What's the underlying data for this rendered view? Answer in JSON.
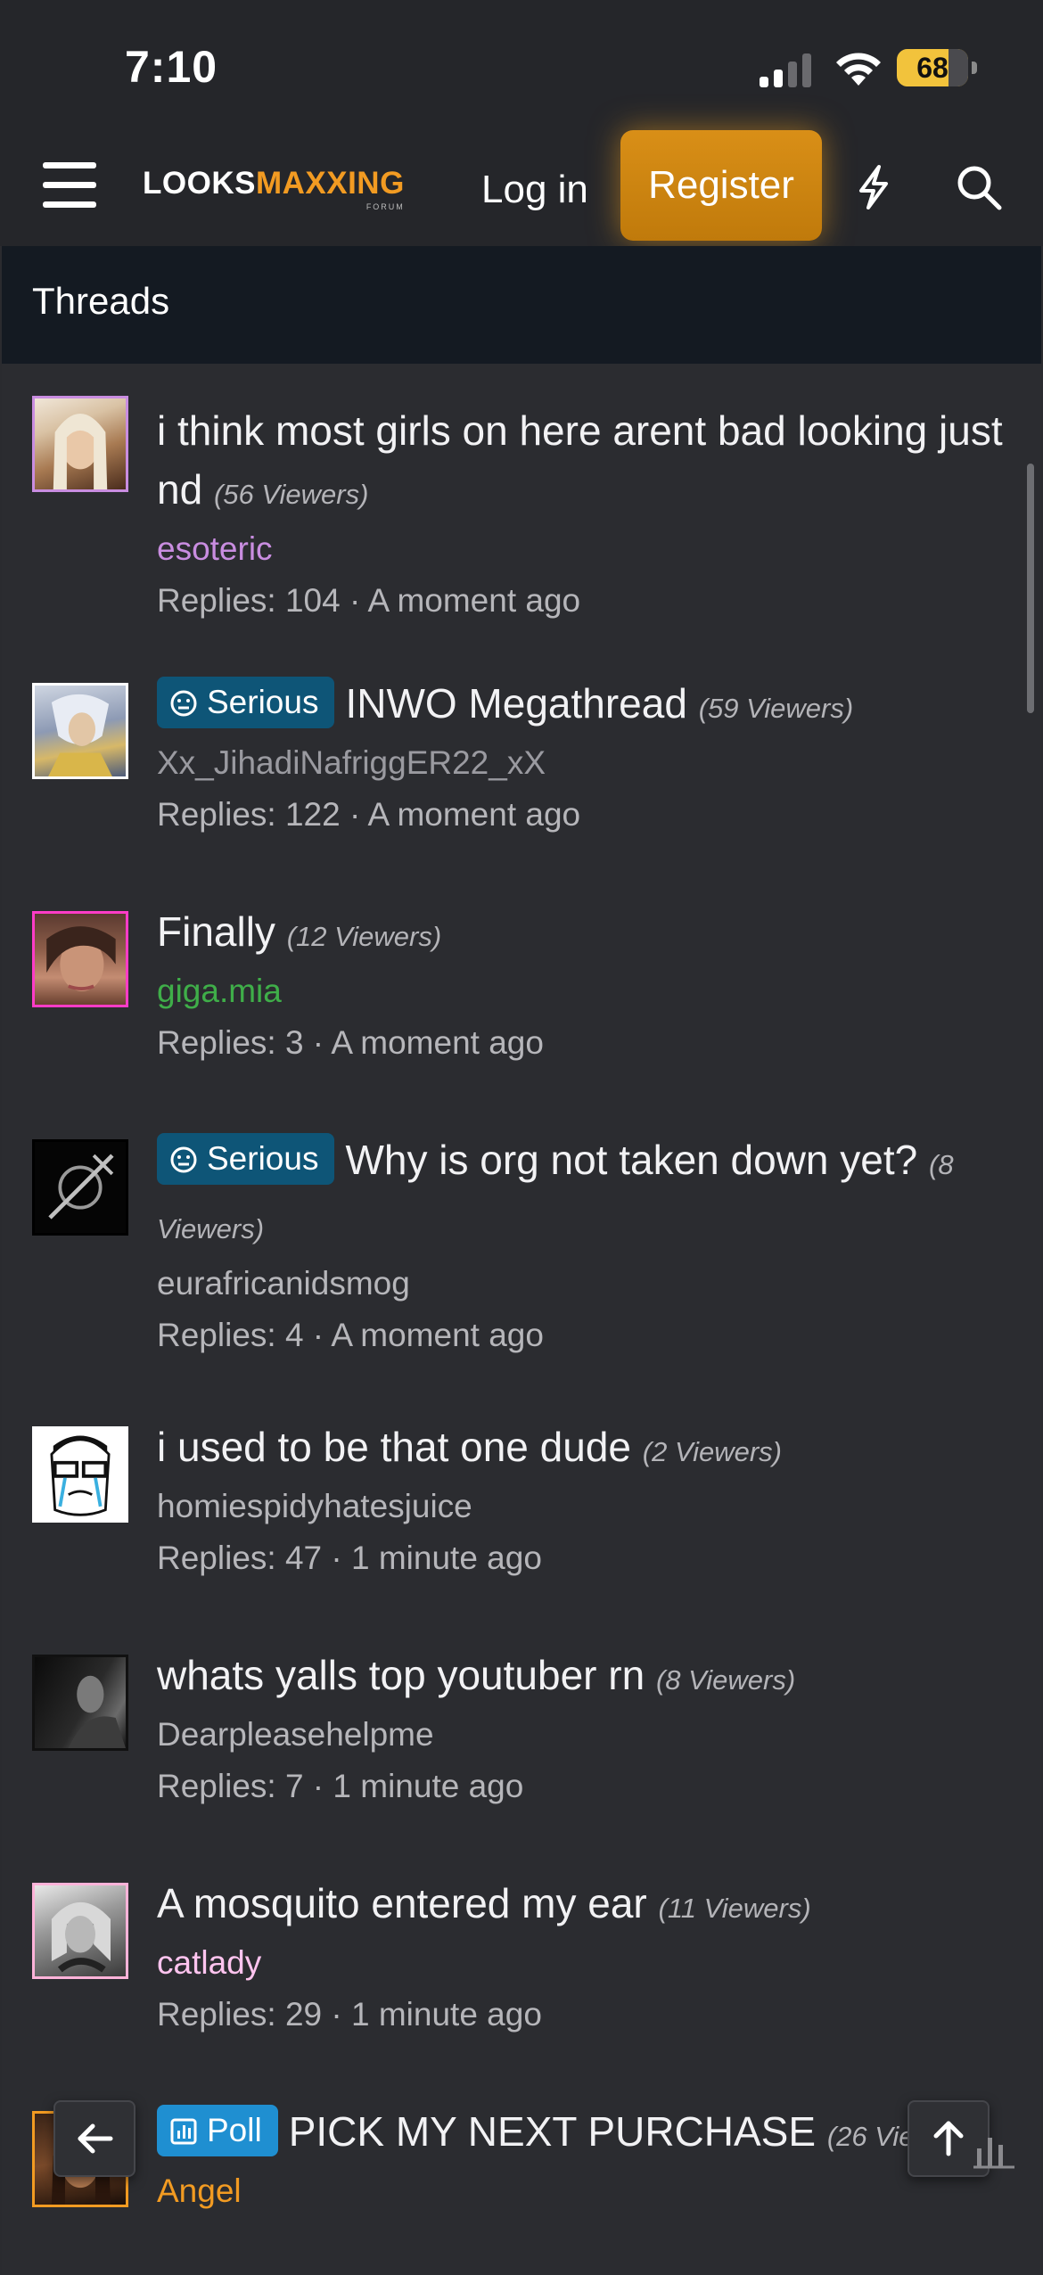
{
  "status_bar": {
    "time": "7:10",
    "battery": "68"
  },
  "nav": {
    "logo_white": "LOOKS",
    "logo_orange": "MAXXING",
    "logo_sub": "FORUM",
    "login_label": "Log in",
    "register_label": "Register"
  },
  "section_title": "Threads",
  "threads": [
    {
      "prefix": "",
      "title": "i think most girls on here arent bad looking just nd",
      "viewers": "(56 Viewers)",
      "author": "esoteric",
      "author_color": "#c98de0",
      "meta": "Replies: 104 · A moment ago",
      "avatar_border": "#c98de0"
    },
    {
      "prefix": "Serious",
      "title": "INWO Megathread",
      "viewers": "(59 Viewers)",
      "author": "Xx_JihadiNafriggER22_xX",
      "author_color": "#9a9aa0",
      "meta": "Replies: 122 · A moment ago",
      "avatar_border": "#ffffff"
    },
    {
      "prefix": "",
      "title": "Finally",
      "viewers": "(12 Viewers)",
      "author": "giga.mia",
      "author_color": "#3fae49",
      "meta": "Replies: 3 · A moment ago",
      "avatar_border": "#ff3cc7"
    },
    {
      "prefix": "Serious",
      "title": "Why is org not taken down yet?",
      "viewers": "(8 Viewers)",
      "author": "eurafricanidsmog",
      "author_color": "#b6b6ba",
      "meta": "Replies: 4 · A moment ago",
      "avatar_border": "#000000"
    },
    {
      "prefix": "",
      "title": "i used to be that one dude",
      "viewers": "(2 Viewers)",
      "author": "homiespidyhatesjuice",
      "author_color": "#b6b6ba",
      "meta": "Replies: 47 · 1 minute ago",
      "avatar_border": "#ffffff"
    },
    {
      "prefix": "",
      "title": "whats yalls top youtuber rn",
      "viewers": "(8 Viewers)",
      "author": "Dearpleasehelpme",
      "author_color": "#b6b6ba",
      "meta": "Replies: 7 · 1 minute ago",
      "avatar_border": "#111111"
    },
    {
      "prefix": "",
      "title": "A mosquito entered my ear",
      "viewers": "(11 Viewers)",
      "author": "catlady",
      "author_color": "#ffc4ef",
      "meta": "Replies: 29 · 1 minute ago",
      "avatar_border": "#ffb3d9"
    },
    {
      "prefix": "Poll",
      "title": "PICK MY NEXT PURCHASE",
      "viewers": "(26 Viewers)",
      "author": "Angel",
      "author_color": "#f29b22",
      "meta": "",
      "avatar_border": "#f29b22"
    }
  ]
}
